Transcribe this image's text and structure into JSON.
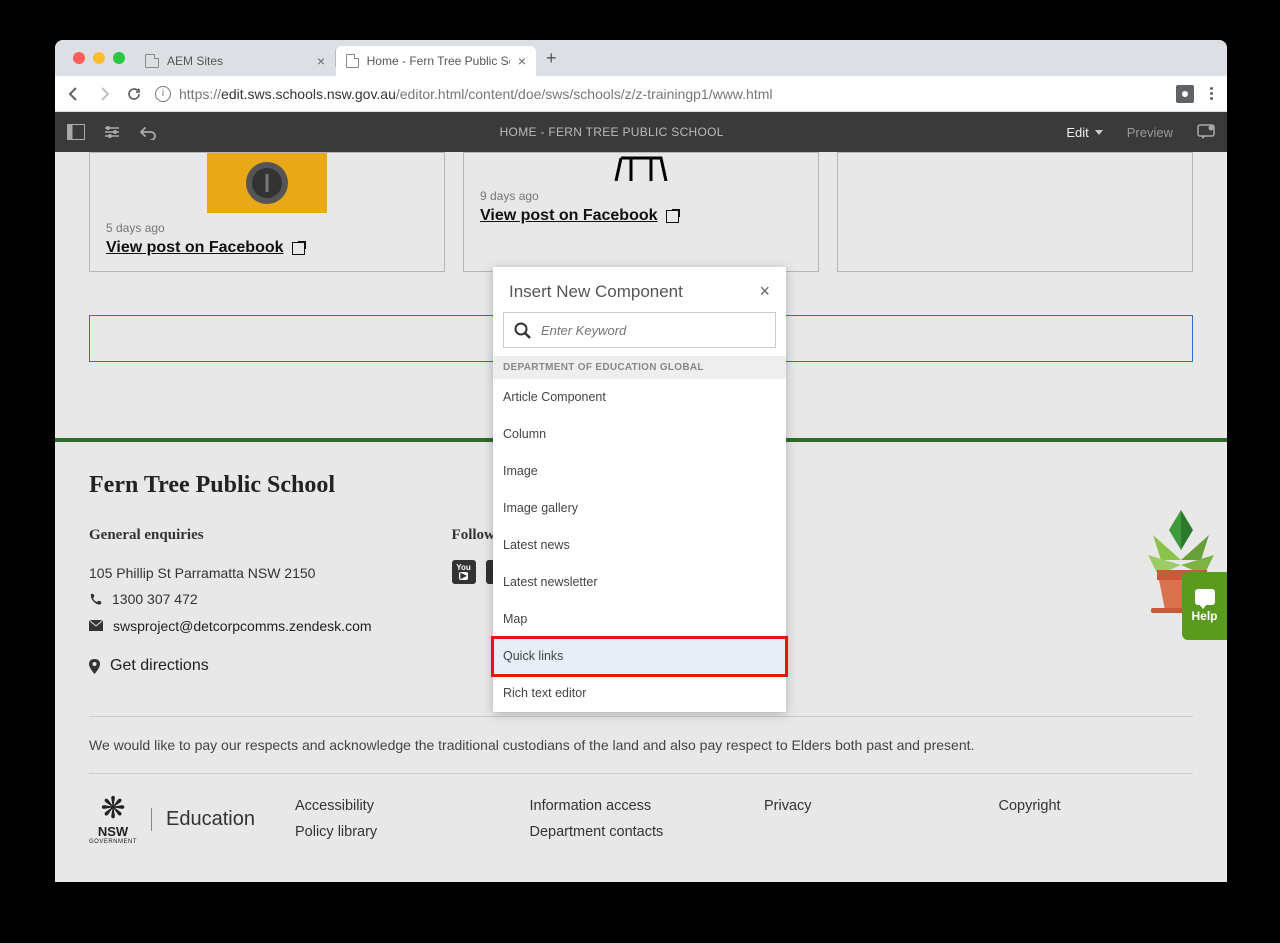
{
  "tabs": [
    {
      "label": "AEM Sites",
      "active": false
    },
    {
      "label": "Home - Fern Tree Public Scho",
      "active": true
    }
  ],
  "url": {
    "prefix": "https://",
    "host": "edit.sws.schools.nsw.gov.au",
    "path": "/editor.html/content/doe/sws/schools/z/z-trainingp1/www.html"
  },
  "aem": {
    "title": "HOME - FERN TREE PUBLIC SCHOOL",
    "edit": "Edit",
    "preview": "Preview"
  },
  "cards": [
    {
      "days": "5 days ago",
      "link": "View post on Facebook"
    },
    {
      "days": "9 days ago",
      "link": "View post on Facebook"
    }
  ],
  "footer": {
    "school": "Fern Tree Public School",
    "enquiries_h": "General enquiries",
    "address": "105 Phillip St Parramatta NSW 2150",
    "phone": "1300 307 472",
    "email": "swsproject@detcorpcomms.zendesk.com",
    "directions": "Get directions",
    "follow_h": "Follow us",
    "ack": "We would like to pay our respects and acknowledge the traditional custodians of the land and also pay respect to Elders both past and present.",
    "links": {
      "accessibility": "Accessibility",
      "info": "Information access",
      "privacy": "Privacy",
      "copyright": "Copyright",
      "policy": "Policy library",
      "contacts": "Department contacts"
    },
    "nsw": "NSW",
    "gov": "GOVERNMENT",
    "edu": "Education"
  },
  "help": "Help",
  "dialog": {
    "title": "Insert New Component",
    "placeholder": "Enter Keyword",
    "group": "DEPARTMENT OF EDUCATION GLOBAL",
    "items": [
      "Article Component",
      "Column",
      "Image",
      "Image gallery",
      "Latest news",
      "Latest newsletter",
      "Map",
      "Quick links",
      "Rich text editor"
    ],
    "highlight_index": 7
  }
}
